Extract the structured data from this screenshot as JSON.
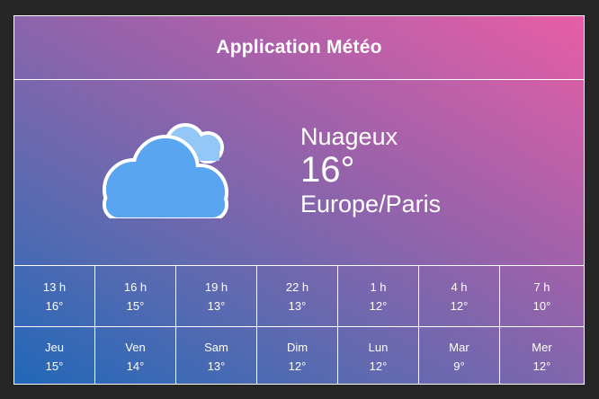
{
  "app": {
    "title": "Application Météo"
  },
  "current": {
    "icon": "cloudy-icon",
    "condition": "Nuageux",
    "temperature": "16°",
    "timezone": "Europe/Paris"
  },
  "hourly": [
    {
      "time": "13 h",
      "temp": "16°"
    },
    {
      "time": "16 h",
      "temp": "15°"
    },
    {
      "time": "19 h",
      "temp": "13°"
    },
    {
      "time": "22 h",
      "temp": "13°"
    },
    {
      "time": "1 h",
      "temp": "12°"
    },
    {
      "time": "4 h",
      "temp": "12°"
    },
    {
      "time": "7 h",
      "temp": "10°"
    }
  ],
  "daily": [
    {
      "day": "Jeu",
      "temp": "15°"
    },
    {
      "day": "Ven",
      "temp": "14°"
    },
    {
      "day": "Sam",
      "temp": "13°"
    },
    {
      "day": "Dim",
      "temp": "12°"
    },
    {
      "day": "Lun",
      "temp": "12°"
    },
    {
      "day": "Mar",
      "temp": "9°"
    },
    {
      "day": "Mer",
      "temp": "12°"
    }
  ],
  "colors": {
    "gradient_start": "#2168b8",
    "gradient_end": "#e85ea6",
    "cloud_front": "#5aa5ef",
    "cloud_back": "#93c7f7",
    "background": "#262626"
  }
}
